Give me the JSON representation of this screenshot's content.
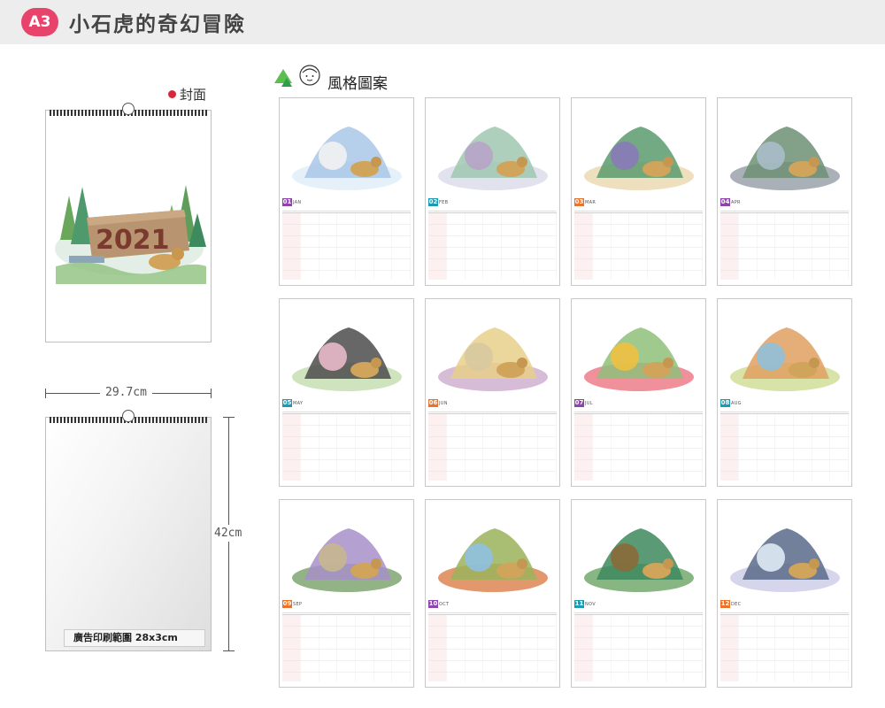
{
  "header": {
    "badge": "A3",
    "title": "小石虎的奇幻冒險"
  },
  "cover": {
    "label": "封面",
    "year": "2021"
  },
  "dimensions": {
    "width": "29.7cm",
    "height": "42cm"
  },
  "ad_area": {
    "label": "廣告印刷範圍 28x3cm"
  },
  "style_section": {
    "label": "風格圖案"
  },
  "months": [
    {
      "num": "01",
      "name": "JAN",
      "color": "#8e44ad"
    },
    {
      "num": "02",
      "name": "FEB",
      "color": "#1a9bb4"
    },
    {
      "num": "03",
      "name": "MAR",
      "color": "#e8732c"
    },
    {
      "num": "04",
      "name": "APR",
      "color": "#8e44ad"
    },
    {
      "num": "05",
      "name": "MAY",
      "color": "#1a9bb4"
    },
    {
      "num": "06",
      "name": "JUN",
      "color": "#e8732c"
    },
    {
      "num": "07",
      "name": "JUL",
      "color": "#8e44ad"
    },
    {
      "num": "08",
      "name": "AUG",
      "color": "#1a9bb4"
    },
    {
      "num": "09",
      "name": "SEP",
      "color": "#e8732c"
    },
    {
      "num": "10",
      "name": "OCT",
      "color": "#8e44ad"
    },
    {
      "num": "11",
      "name": "NOV",
      "color": "#1a9bb4"
    },
    {
      "num": "12",
      "name": "DEC",
      "color": "#e8732c"
    }
  ]
}
